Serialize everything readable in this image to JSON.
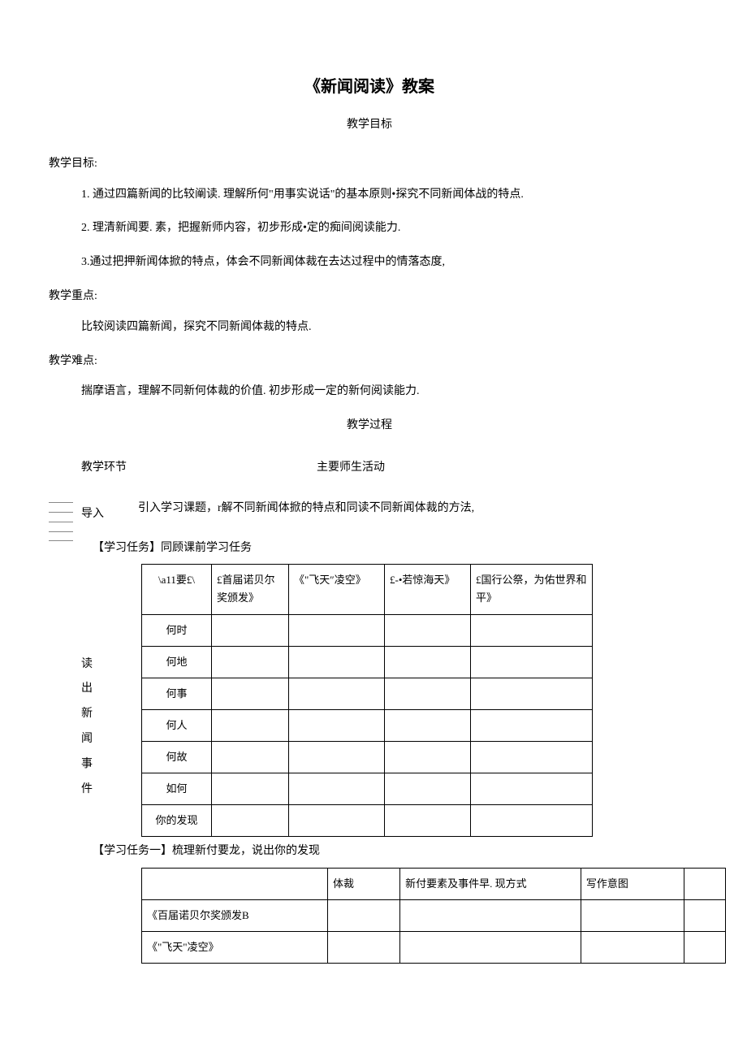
{
  "title": "《新闻阅读》教案",
  "subtitle1": "教学目标",
  "sect_goal_h": "教学目标:",
  "goal1": "1. 通过四篇新闻的比较阐读. 理解所何\"用事实说话\"的基本原则•探究不同新闻体战的特点.",
  "goal2": "2. 理清新闻要. 素，把握新师内容，初步形成•定的痴间阅读能力.",
  "goal3": "3.通过把押新闻体掀的特点，体会不同新闻体裁在去达过程中的情落态度,",
  "sect_focus_h": "教学重点:",
  "focus1": "比较阅读四篇新闻，探究不同新闻体裁的特点.",
  "sect_diff_h": "教学难点:",
  "diff1": "揣摩语言，理解不同新何体裁的价值. 初步形成一定的新何阅读能力.",
  "process_title": "教学过程",
  "col_left": "教学环节",
  "col_right": "主要师生活动",
  "intro_label": "导入",
  "intro_text": "引入学习课题，r解不同新闻体掀的特点和同读不同新闻体裁的方法,",
  "task0_label": "【学习任务】同顾课前学习任务",
  "section_label": "读出新闻事件",
  "t1": {
    "h0": "\\a11要£\\",
    "h1": "£首届诺贝尔奖颁发》",
    "h2": "《\"飞天″凌空》",
    "h3": "£-•若惊海天》",
    "h4": "£国行公祭，为佑世界和平》",
    "r1": "何时",
    "r2": "何地",
    "r3": "何事",
    "r4": "何人",
    "r5": "何故",
    "r6": "如何",
    "r7": "你的发现"
  },
  "task1_label": "【学习任务一】梳理新付要龙，说出你的发现",
  "t2": {
    "h1": "体裁",
    "h2": "新付要素及事件早. 现方式",
    "h3": "写作意图",
    "r1": "《百届诺贝尔奖颁发B",
    "r2": "《\"飞天\"凌空》"
  }
}
